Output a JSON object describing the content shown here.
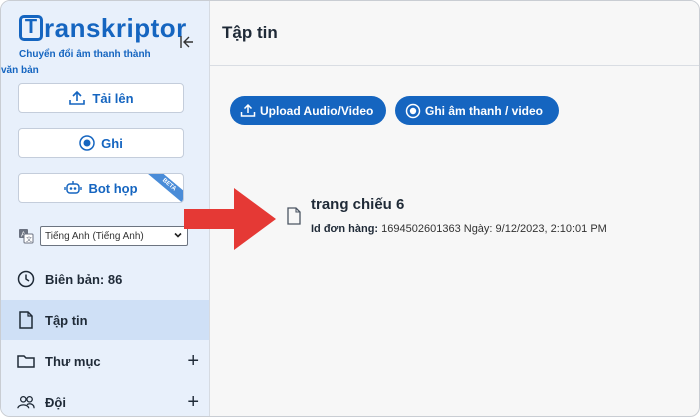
{
  "app": {
    "logo_letter": "T",
    "logo_rest": "ranskriptor",
    "tagline_line1": "Chuyển đổi âm thanh thành",
    "tagline_line2": "văn bản",
    "collapse_icon": "collapse-left-icon"
  },
  "sidebar": {
    "upload_label": "Tải lên",
    "record_label": "Ghi",
    "bot_label": "Bot họp",
    "bot_badge": "BETA",
    "language": "Tiếng Anh (Tiếng Anh)",
    "nav": [
      {
        "label": "Biên bản: 86",
        "icon": "clock-icon"
      },
      {
        "label": "Tập tin",
        "icon": "file-icon"
      },
      {
        "label": "Thư mục",
        "icon": "folder-icon"
      },
      {
        "label": "Đội",
        "icon": "team-icon"
      }
    ]
  },
  "header": {
    "title": "Tập tin"
  },
  "main": {
    "upload_button": "Upload Audio/Video",
    "record_button": "Ghi âm thanh / video",
    "file": {
      "name": "trang chiếu 6",
      "id_label": "Id đơn hàng:",
      "id_value": "1694502601363",
      "date_text": "Ngày: 9/12/2023, 2:10:01 PM"
    }
  },
  "colors": {
    "accent": "#1565c0",
    "sidebar_bg": "#e8f0fb",
    "active_nav_bg": "#cfe0f6",
    "arrow": "#e53935"
  }
}
